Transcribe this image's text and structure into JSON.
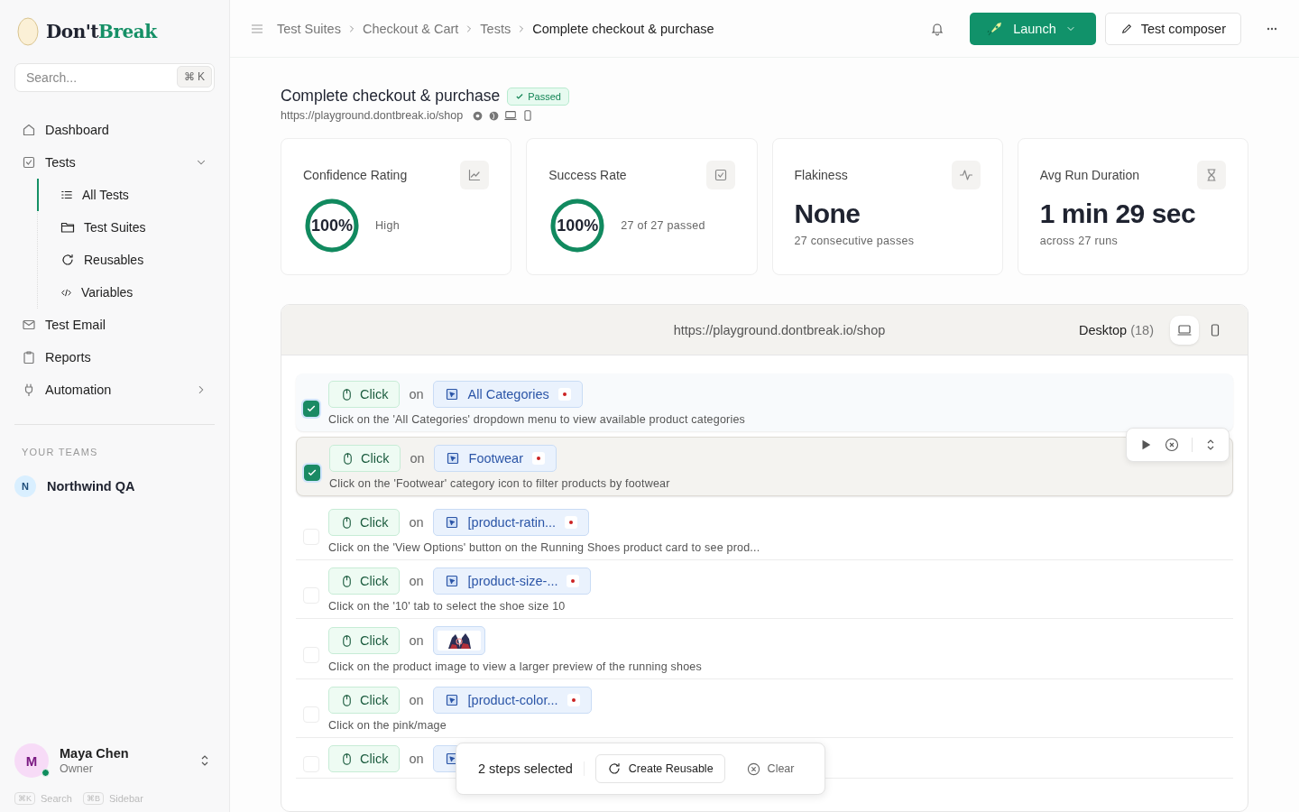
{
  "sidebar": {
    "logo_parts": [
      "Don't",
      "Break"
    ],
    "search": {
      "placeholder": "Search...",
      "shortcut": "⌘ K"
    },
    "nav": [
      {
        "label": "Dashboard"
      },
      {
        "label": "Tests",
        "expanded": true,
        "children": [
          {
            "label": "All Tests",
            "selected": true
          },
          {
            "label": "Test Suites",
            "selected": false
          },
          {
            "label": "Reusables",
            "selected": false
          },
          {
            "label": "Variables",
            "selected": false
          }
        ]
      },
      {
        "label": "Test Email"
      },
      {
        "label": "Reports"
      },
      {
        "label": "Automation",
        "expanded": false
      }
    ],
    "teams_heading": "YOUR TEAMS",
    "teams": [
      {
        "initial": "N",
        "name": "Northwind QA"
      }
    ],
    "user": {
      "initial": "M",
      "name": "Maya Chen",
      "role": "Owner",
      "online": true
    },
    "shortcuts": [
      {
        "key": "⌘K",
        "label": "Search"
      },
      {
        "key": "⌘B",
        "label": "Sidebar"
      }
    ]
  },
  "header": {
    "breadcrumbs": [
      "Test Suites",
      "Checkout & Cart",
      "Tests",
      "Complete checkout & purchase"
    ],
    "launch": "Launch",
    "composer": "Test composer"
  },
  "test": {
    "title": "Complete checkout & purchase",
    "status": "Passed",
    "url": "https://playground.dontbreak.io/shop"
  },
  "stats": [
    {
      "kind": "ring",
      "title": "Confidence Rating",
      "value": "100%",
      "level": 1,
      "caption": "High"
    },
    {
      "kind": "ring",
      "title": "Success Rate",
      "value": "100%",
      "level": 1,
      "caption": "27 of 27 passed"
    },
    {
      "kind": "big",
      "title": "Flakiness",
      "value": "None",
      "caption": "27 consecutive passes"
    },
    {
      "kind": "big",
      "title": "Avg Run Duration",
      "value": "1 min 29 sec",
      "caption": "across 27 runs"
    }
  ],
  "steps_panel": {
    "url": "https://playground.dontbreak.io/shop",
    "device": "Desktop",
    "count": "(18)",
    "views": [
      {
        "kind": "desktop",
        "selected": true
      },
      {
        "kind": "mobile",
        "selected": false
      }
    ],
    "steps": [
      {
        "action": "Click",
        "on": "on",
        "target": {
          "kind": "element",
          "label": "All Categories"
        },
        "description": "Click on the 'All Categories' dropdown menu to view available product categories",
        "checked": true,
        "hovered": false
      },
      {
        "action": "Click",
        "on": "on",
        "target": {
          "kind": "element",
          "label": "Footwear"
        },
        "description": "Click on the 'Footwear' category icon to filter products by footwear",
        "checked": true,
        "hovered": true
      },
      {
        "action": "Click",
        "on": "on",
        "target": {
          "kind": "element",
          "label": "[product-ratin..."
        },
        "description": "Click on the 'View Options' button on the Running Shoes product card to see prod...",
        "checked": false,
        "hovered": false
      },
      {
        "action": "Click",
        "on": "on",
        "target": {
          "kind": "element",
          "label": "[product-size-..."
        },
        "description": "Click on the '10' tab to select the shoe size 10",
        "checked": false,
        "hovered": false
      },
      {
        "action": "Click",
        "on": "on",
        "description": "Click on the product image to view a larger preview of the running shoes",
        "checked": false,
        "hovered": false
      },
      {
        "action": "Click",
        "on": "on",
        "target": {
          "kind": "element",
          "label": "[product-color..."
        },
        "description": "Click on the pink/mage",
        "checked": false,
        "hovered": false
      },
      {
        "action": "Click",
        "on": "on",
        "target": {
          "kind": "element"
        },
        "checked": false,
        "hovered": false
      }
    ]
  },
  "selection_bar": {
    "count": "2 steps selected",
    "create": "Create Reusable",
    "clear": "Clear"
  }
}
